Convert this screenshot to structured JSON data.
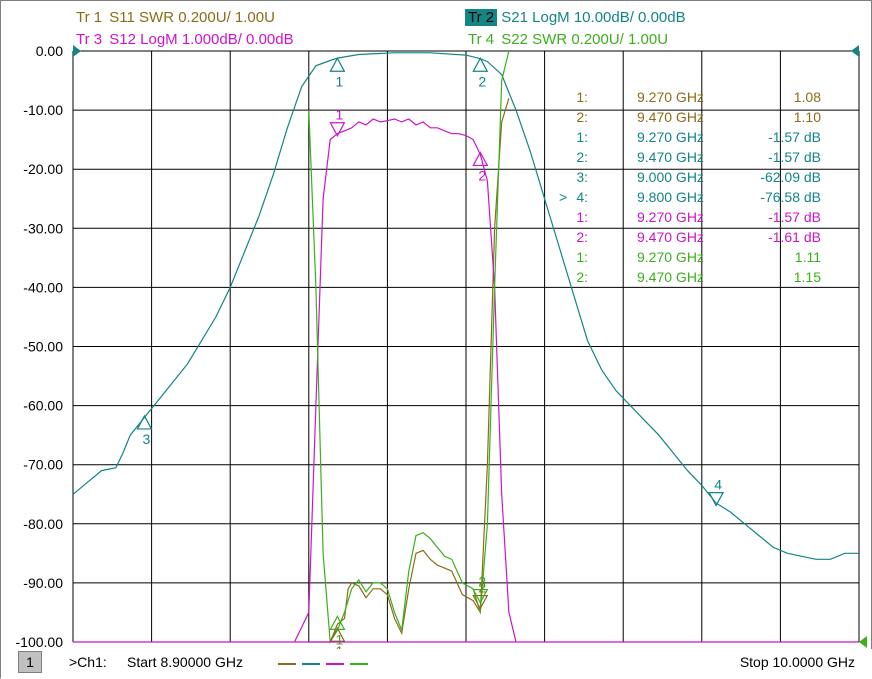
{
  "colors": {
    "tr1": "#8c6c19",
    "tr2": "#138585",
    "tr3": "#cc14cc",
    "tr4": "#3caf1c",
    "grid": "#000000",
    "background": "#ffffff"
  },
  "headers": [
    {
      "tr": "Tr 1",
      "desc": "S11 SWR 0.200U/  1.00U",
      "color": "#8c6c19",
      "active": false
    },
    {
      "tr": "Tr 2",
      "desc": "S21 LogM 10.00dB/  0.00dB",
      "color": "#138585",
      "active": true
    },
    {
      "tr": "Tr 3",
      "desc": "S12 LogM 1.000dB/  0.00dB",
      "color": "#cc14cc",
      "active": false
    },
    {
      "tr": "Tr 4",
      "desc": "S22 SWR 0.200U/  1.00U",
      "color": "#3caf1c",
      "active": false
    }
  ],
  "footer": {
    "channel_number": "1",
    "channel_label": ">Ch1:",
    "start": "Start  8.90000 GHz",
    "stop": "Stop  10.0000 GHz"
  },
  "marker_table": [
    {
      "prefix": "",
      "num": "1:",
      "freq": "9.270 GHz",
      "value": "1.08",
      "color": "#8c6c19"
    },
    {
      "prefix": "",
      "num": "2:",
      "freq": "9.470 GHz",
      "value": "1.10",
      "color": "#8c6c19"
    },
    {
      "prefix": "",
      "num": "1:",
      "freq": "9.270 GHz",
      "value": "-1.57 dB",
      "color": "#138585"
    },
    {
      "prefix": "",
      "num": "2:",
      "freq": "9.470 GHz",
      "value": "-1.57 dB",
      "color": "#138585"
    },
    {
      "prefix": "",
      "num": "3:",
      "freq": "9.000 GHz",
      "value": "-62.09 dB",
      "color": "#138585"
    },
    {
      "prefix": ">",
      "num": "4:",
      "freq": "9.800 GHz",
      "value": "-76.58 dB",
      "color": "#138585"
    },
    {
      "prefix": "",
      "num": "1:",
      "freq": "9.270 GHz",
      "value": "-1.57 dB",
      "color": "#cc14cc"
    },
    {
      "prefix": "",
      "num": "2:",
      "freq": "9.470 GHz",
      "value": "-1.61 dB",
      "color": "#cc14cc"
    },
    {
      "prefix": "",
      "num": "1:",
      "freq": "9.270 GHz",
      "value": "1.11",
      "color": "#3caf1c"
    },
    {
      "prefix": "",
      "num": "2:",
      "freq": "9.470 GHz",
      "value": "1.15",
      "color": "#3caf1c"
    }
  ],
  "chart_data": {
    "type": "line",
    "xlim": [
      8.9,
      10.0
    ],
    "x_unit": "GHz",
    "ylim": [
      -100,
      0
    ],
    "y_ticks": [
      "0.00",
      "-10.00",
      "-20.00",
      "-30.00",
      "-40.00",
      "-50.00",
      "-60.00",
      "-70.00",
      "-80.00",
      "-90.00",
      "-100.00"
    ],
    "y_tick_values": [
      0,
      -10,
      -20,
      -30,
      -40,
      -50,
      -60,
      -70,
      -80,
      -90,
      -100
    ],
    "x_divisions": 10,
    "grid": true,
    "series": [
      {
        "trace": "Tr 1",
        "color": "#8c6c19",
        "points": [
          [
            9.23,
            -100
          ],
          [
            9.26,
            -100
          ],
          [
            9.27,
            -97
          ],
          [
            9.28,
            -96
          ],
          [
            9.285,
            -91
          ],
          [
            9.29,
            -90
          ],
          [
            9.3,
            -90.5
          ],
          [
            9.31,
            -92.5
          ],
          [
            9.32,
            -91
          ],
          [
            9.33,
            -91
          ],
          [
            9.34,
            -92
          ],
          [
            9.35,
            -96
          ],
          [
            9.36,
            -98.5
          ],
          [
            9.37,
            -91
          ],
          [
            9.38,
            -85
          ],
          [
            9.39,
            -84.5
          ],
          [
            9.4,
            -86
          ],
          [
            9.41,
            -87
          ],
          [
            9.42,
            -87.5
          ],
          [
            9.43,
            -88
          ],
          [
            9.445,
            -92
          ],
          [
            9.46,
            -93
          ],
          [
            9.47,
            -95
          ],
          [
            9.48,
            -70
          ],
          [
            9.49,
            -30
          ],
          [
            9.5,
            -12
          ],
          [
            9.51,
            -8
          ]
        ]
      },
      {
        "trace": "Tr 2",
        "color": "#138585",
        "points": [
          [
            8.9,
            -75
          ],
          [
            8.92,
            -73
          ],
          [
            8.94,
            -71
          ],
          [
            8.96,
            -70.5
          ],
          [
            8.97,
            -68
          ],
          [
            8.98,
            -65
          ],
          [
            9.0,
            -62
          ],
          [
            9.02,
            -59
          ],
          [
            9.04,
            -56
          ],
          [
            9.06,
            -53
          ],
          [
            9.08,
            -49
          ],
          [
            9.1,
            -45
          ],
          [
            9.12,
            -40
          ],
          [
            9.14,
            -34
          ],
          [
            9.16,
            -28
          ],
          [
            9.18,
            -21
          ],
          [
            9.2,
            -13
          ],
          [
            9.22,
            -6
          ],
          [
            9.24,
            -2.5
          ],
          [
            9.26,
            -1.6
          ],
          [
            9.27,
            -1.2
          ],
          [
            9.3,
            -0.6
          ],
          [
            9.35,
            -0.3
          ],
          [
            9.4,
            -0.3
          ],
          [
            9.45,
            -0.7
          ],
          [
            9.47,
            -1.3
          ],
          [
            9.48,
            -1.8
          ],
          [
            9.5,
            -4
          ],
          [
            9.52,
            -10
          ],
          [
            9.54,
            -17
          ],
          [
            9.56,
            -25
          ],
          [
            9.58,
            -33
          ],
          [
            9.6,
            -41
          ],
          [
            9.62,
            -49
          ],
          [
            9.64,
            -54
          ],
          [
            9.66,
            -57.5
          ],
          [
            9.68,
            -60
          ],
          [
            9.7,
            -62.5
          ],
          [
            9.72,
            -65
          ],
          [
            9.74,
            -68
          ],
          [
            9.76,
            -71
          ],
          [
            9.78,
            -73.5
          ],
          [
            9.8,
            -76.5
          ],
          [
            9.82,
            -78
          ],
          [
            9.84,
            -80
          ],
          [
            9.86,
            -82
          ],
          [
            9.88,
            -84
          ],
          [
            9.9,
            -85
          ],
          [
            9.92,
            -85.5
          ],
          [
            9.94,
            -86
          ],
          [
            9.96,
            -86
          ],
          [
            9.98,
            -85
          ],
          [
            10.0,
            -85
          ]
        ]
      },
      {
        "trace": "Tr 3",
        "color": "#cc14cc",
        "points": [
          [
            9.21,
            -100
          ],
          [
            9.23,
            -95
          ],
          [
            9.24,
            -60
          ],
          [
            9.25,
            -25
          ],
          [
            9.26,
            -15
          ],
          [
            9.27,
            -14
          ],
          [
            9.28,
            -13.5
          ],
          [
            9.29,
            -13
          ],
          [
            9.3,
            -12
          ],
          [
            9.31,
            -12.5
          ],
          [
            9.32,
            -11.5
          ],
          [
            9.33,
            -12
          ],
          [
            9.34,
            -11.8
          ],
          [
            9.35,
            -11.5
          ],
          [
            9.36,
            -12
          ],
          [
            9.37,
            -11.5
          ],
          [
            9.38,
            -12.5
          ],
          [
            9.39,
            -12
          ],
          [
            9.4,
            -13
          ],
          [
            9.41,
            -13
          ],
          [
            9.42,
            -13.5
          ],
          [
            9.43,
            -14
          ],
          [
            9.44,
            -14
          ],
          [
            9.45,
            -14.3
          ],
          [
            9.46,
            -15
          ],
          [
            9.47,
            -17.5
          ],
          [
            9.48,
            -22
          ],
          [
            9.49,
            -40
          ],
          [
            9.5,
            -75
          ],
          [
            9.51,
            -95
          ],
          [
            9.52,
            -100
          ]
        ]
      },
      {
        "trace": "Tr 4",
        "color": "#3caf1c",
        "points": [
          [
            9.23,
            -10
          ],
          [
            9.24,
            -40
          ],
          [
            9.25,
            -85
          ],
          [
            9.26,
            -100
          ],
          [
            9.27,
            -98
          ],
          [
            9.28,
            -95
          ],
          [
            9.29,
            -91
          ],
          [
            9.3,
            -89.5
          ],
          [
            9.31,
            -91.5
          ],
          [
            9.32,
            -90
          ],
          [
            9.33,
            -90
          ],
          [
            9.34,
            -91
          ],
          [
            9.35,
            -95
          ],
          [
            9.36,
            -98
          ],
          [
            9.37,
            -88
          ],
          [
            9.38,
            -82
          ],
          [
            9.39,
            -81.5
          ],
          [
            9.4,
            -82.5
          ],
          [
            9.41,
            -84
          ],
          [
            9.42,
            -85.5
          ],
          [
            9.43,
            -86
          ],
          [
            9.445,
            -90
          ],
          [
            9.46,
            -91
          ],
          [
            9.47,
            -95
          ],
          [
            9.48,
            -80
          ],
          [
            9.49,
            -40
          ],
          [
            9.5,
            -5
          ],
          [
            9.51,
            0
          ]
        ]
      }
    ],
    "markers": [
      {
        "trace": "Tr 1",
        "label": "1",
        "x": 9.27,
        "y": -98,
        "direction": "up",
        "color": "#8c6c19"
      },
      {
        "trace": "Tr 1",
        "label": "2",
        "x": 9.47,
        "y": -94,
        "direction": "down",
        "color": "#8c6c19"
      },
      {
        "trace": "Tr 2",
        "label": "1",
        "x": 9.27,
        "y": -1.57,
        "direction": "up",
        "color": "#138585"
      },
      {
        "trace": "Tr 2",
        "label": "2",
        "x": 9.47,
        "y": -1.57,
        "direction": "up",
        "color": "#138585"
      },
      {
        "trace": "Tr 2",
        "label": "3",
        "x": 9.0,
        "y": -62.09,
        "direction": "up",
        "color": "#138585"
      },
      {
        "trace": "Tr 2",
        "label": "4",
        "x": 9.8,
        "y": -76.58,
        "direction": "down",
        "color": "#138585"
      },
      {
        "trace": "Tr 3",
        "label": "1",
        "x": 9.27,
        "y": -14,
        "direction": "down",
        "color": "#cc14cc"
      },
      {
        "trace": "Tr 3",
        "label": "2",
        "x": 9.47,
        "y": -17.5,
        "direction": "up",
        "color": "#cc14cc"
      },
      {
        "trace": "Tr 4",
        "label": "1",
        "x": 9.27,
        "y": -96,
        "direction": "up",
        "color": "#3caf1c"
      },
      {
        "trace": "Tr 4",
        "label": "2",
        "x": 9.47,
        "y": -93,
        "direction": "down",
        "color": "#3caf1c"
      }
    ]
  }
}
